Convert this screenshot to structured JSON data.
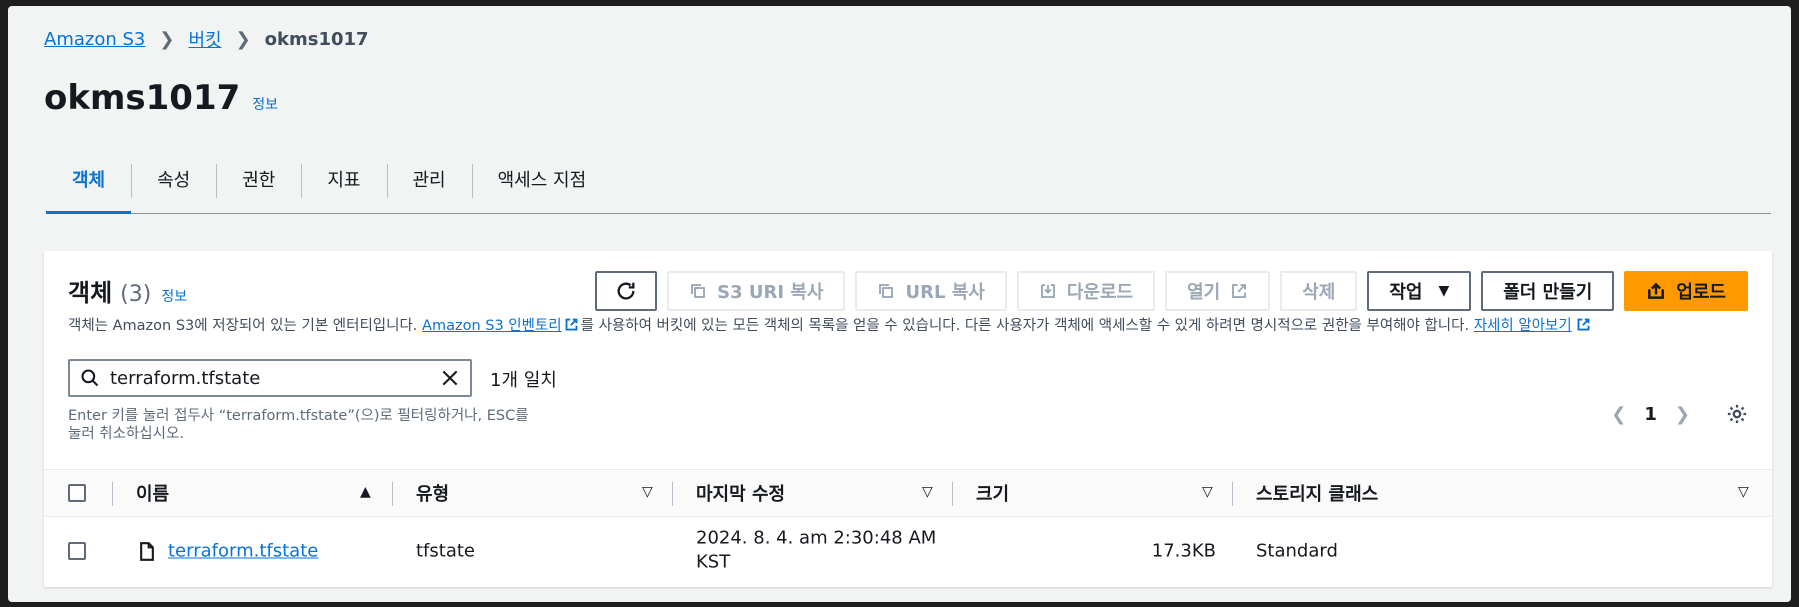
{
  "breadcrumb": {
    "service": "Amazon S3",
    "buckets": "버킷",
    "current": "okms1017"
  },
  "page": {
    "title": "okms1017",
    "info": "정보"
  },
  "tabs": [
    "객체",
    "속성",
    "권한",
    "지표",
    "관리",
    "액세스 지점"
  ],
  "objects_panel": {
    "title": "객체",
    "count": "(3)",
    "info": "정보",
    "toolbar": {
      "copy_s3_uri": "S3 URI 복사",
      "copy_url": "URL 복사",
      "download": "다운로드",
      "open": "열기",
      "delete": "삭제",
      "actions": "작업",
      "create_folder": "폴더 만들기",
      "upload": "업로드"
    },
    "description": {
      "prefix": "객체는 Amazon S3에 저장되어 있는 기본 엔터티입니다. ",
      "inventory_link": "Amazon S3 인벤토리",
      "middle": "를 사용하여 버킷에 있는 모든 객체의 목록을 얻을 수 있습니다. 다른 사용자가 객체에 액세스할 수 있게 하려면 명시적으로 권한을 부여해야 합니다. ",
      "learn_more": "자세히 알아보기"
    },
    "search": {
      "value": "terraform.tfstate",
      "match_count": "1개 일치",
      "hint": "Enter 키를 눌러 접두사 “terraform.tfstate”(으)로 필터링하거나, ESC를 눌러 취소하십시오."
    },
    "pagination": {
      "page": "1"
    },
    "columns": {
      "name": "이름",
      "type": "유형",
      "last_modified": "마지막 수정",
      "size": "크기",
      "storage_class": "스토리지 클래스"
    },
    "rows": [
      {
        "name": "terraform.tfstate",
        "type": "tfstate",
        "last_modified_line1": "2024. 8. 4. am 2:30:48 AM",
        "last_modified_line2": "KST",
        "size": "17.3KB",
        "storage_class": "Standard"
      }
    ]
  },
  "colors": {
    "link": "#0972d3",
    "primary_button": "#ff9900",
    "background": "#f2f3f3"
  }
}
